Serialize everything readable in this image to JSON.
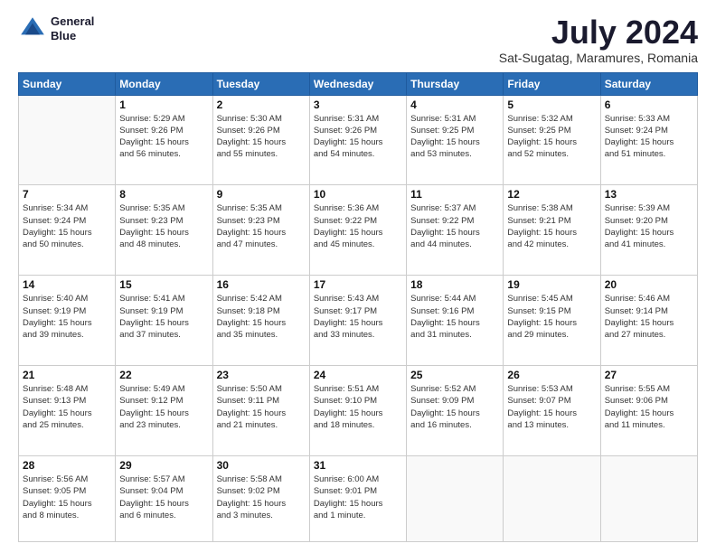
{
  "logo": {
    "line1": "General",
    "line2": "Blue"
  },
  "title": "July 2024",
  "subtitle": "Sat-Sugatag, Maramures, Romania",
  "weekdays": [
    "Sunday",
    "Monday",
    "Tuesday",
    "Wednesday",
    "Thursday",
    "Friday",
    "Saturday"
  ],
  "weeks": [
    [
      {
        "day": "",
        "info": ""
      },
      {
        "day": "1",
        "info": "Sunrise: 5:29 AM\nSunset: 9:26 PM\nDaylight: 15 hours\nand 56 minutes."
      },
      {
        "day": "2",
        "info": "Sunrise: 5:30 AM\nSunset: 9:26 PM\nDaylight: 15 hours\nand 55 minutes."
      },
      {
        "day": "3",
        "info": "Sunrise: 5:31 AM\nSunset: 9:26 PM\nDaylight: 15 hours\nand 54 minutes."
      },
      {
        "day": "4",
        "info": "Sunrise: 5:31 AM\nSunset: 9:25 PM\nDaylight: 15 hours\nand 53 minutes."
      },
      {
        "day": "5",
        "info": "Sunrise: 5:32 AM\nSunset: 9:25 PM\nDaylight: 15 hours\nand 52 minutes."
      },
      {
        "day": "6",
        "info": "Sunrise: 5:33 AM\nSunset: 9:24 PM\nDaylight: 15 hours\nand 51 minutes."
      }
    ],
    [
      {
        "day": "7",
        "info": "Sunrise: 5:34 AM\nSunset: 9:24 PM\nDaylight: 15 hours\nand 50 minutes."
      },
      {
        "day": "8",
        "info": "Sunrise: 5:35 AM\nSunset: 9:23 PM\nDaylight: 15 hours\nand 48 minutes."
      },
      {
        "day": "9",
        "info": "Sunrise: 5:35 AM\nSunset: 9:23 PM\nDaylight: 15 hours\nand 47 minutes."
      },
      {
        "day": "10",
        "info": "Sunrise: 5:36 AM\nSunset: 9:22 PM\nDaylight: 15 hours\nand 45 minutes."
      },
      {
        "day": "11",
        "info": "Sunrise: 5:37 AM\nSunset: 9:22 PM\nDaylight: 15 hours\nand 44 minutes."
      },
      {
        "day": "12",
        "info": "Sunrise: 5:38 AM\nSunset: 9:21 PM\nDaylight: 15 hours\nand 42 minutes."
      },
      {
        "day": "13",
        "info": "Sunrise: 5:39 AM\nSunset: 9:20 PM\nDaylight: 15 hours\nand 41 minutes."
      }
    ],
    [
      {
        "day": "14",
        "info": "Sunrise: 5:40 AM\nSunset: 9:19 PM\nDaylight: 15 hours\nand 39 minutes."
      },
      {
        "day": "15",
        "info": "Sunrise: 5:41 AM\nSunset: 9:19 PM\nDaylight: 15 hours\nand 37 minutes."
      },
      {
        "day": "16",
        "info": "Sunrise: 5:42 AM\nSunset: 9:18 PM\nDaylight: 15 hours\nand 35 minutes."
      },
      {
        "day": "17",
        "info": "Sunrise: 5:43 AM\nSunset: 9:17 PM\nDaylight: 15 hours\nand 33 minutes."
      },
      {
        "day": "18",
        "info": "Sunrise: 5:44 AM\nSunset: 9:16 PM\nDaylight: 15 hours\nand 31 minutes."
      },
      {
        "day": "19",
        "info": "Sunrise: 5:45 AM\nSunset: 9:15 PM\nDaylight: 15 hours\nand 29 minutes."
      },
      {
        "day": "20",
        "info": "Sunrise: 5:46 AM\nSunset: 9:14 PM\nDaylight: 15 hours\nand 27 minutes."
      }
    ],
    [
      {
        "day": "21",
        "info": "Sunrise: 5:48 AM\nSunset: 9:13 PM\nDaylight: 15 hours\nand 25 minutes."
      },
      {
        "day": "22",
        "info": "Sunrise: 5:49 AM\nSunset: 9:12 PM\nDaylight: 15 hours\nand 23 minutes."
      },
      {
        "day": "23",
        "info": "Sunrise: 5:50 AM\nSunset: 9:11 PM\nDaylight: 15 hours\nand 21 minutes."
      },
      {
        "day": "24",
        "info": "Sunrise: 5:51 AM\nSunset: 9:10 PM\nDaylight: 15 hours\nand 18 minutes."
      },
      {
        "day": "25",
        "info": "Sunrise: 5:52 AM\nSunset: 9:09 PM\nDaylight: 15 hours\nand 16 minutes."
      },
      {
        "day": "26",
        "info": "Sunrise: 5:53 AM\nSunset: 9:07 PM\nDaylight: 15 hours\nand 13 minutes."
      },
      {
        "day": "27",
        "info": "Sunrise: 5:55 AM\nSunset: 9:06 PM\nDaylight: 15 hours\nand 11 minutes."
      }
    ],
    [
      {
        "day": "28",
        "info": "Sunrise: 5:56 AM\nSunset: 9:05 PM\nDaylight: 15 hours\nand 8 minutes."
      },
      {
        "day": "29",
        "info": "Sunrise: 5:57 AM\nSunset: 9:04 PM\nDaylight: 15 hours\nand 6 minutes."
      },
      {
        "day": "30",
        "info": "Sunrise: 5:58 AM\nSunset: 9:02 PM\nDaylight: 15 hours\nand 3 minutes."
      },
      {
        "day": "31",
        "info": "Sunrise: 6:00 AM\nSunset: 9:01 PM\nDaylight: 15 hours\nand 1 minute."
      },
      {
        "day": "",
        "info": ""
      },
      {
        "day": "",
        "info": ""
      },
      {
        "day": "",
        "info": ""
      }
    ]
  ]
}
